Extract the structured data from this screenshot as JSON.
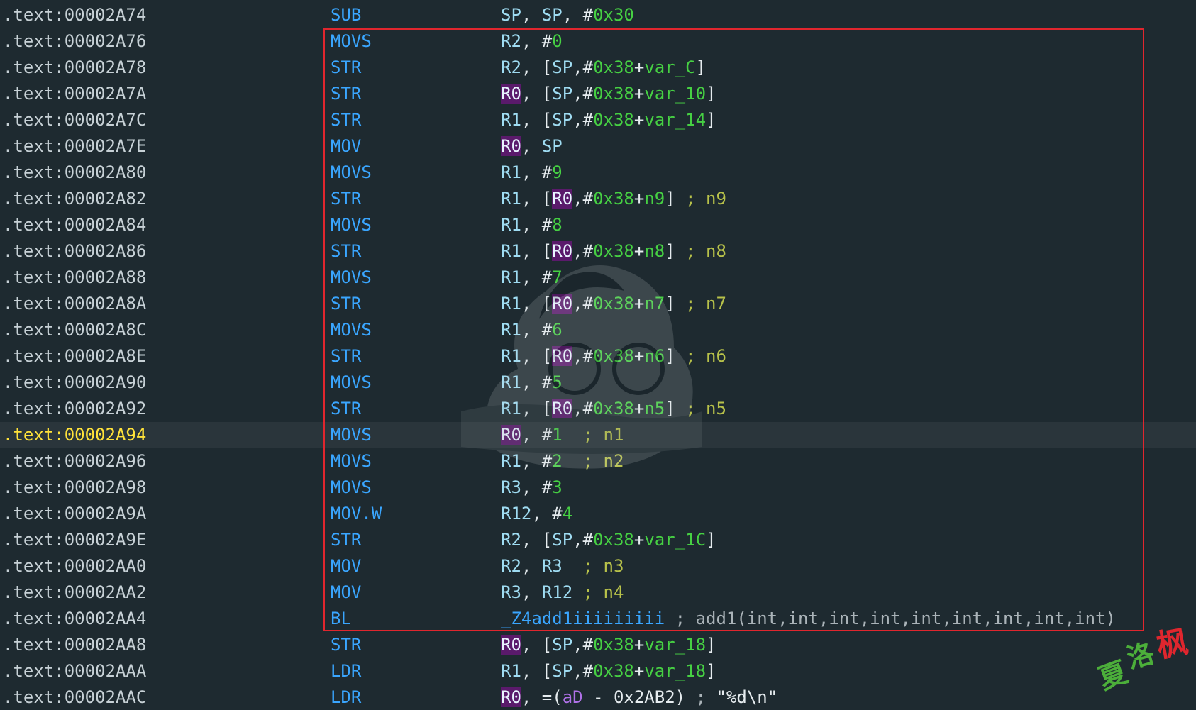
{
  "rows": [
    {
      "addr": ".text:00002A74",
      "mnem": "SUB",
      "ops": [
        [
          "reg",
          "SP"
        ],
        [
          "punc",
          ", "
        ],
        [
          "reg",
          "SP"
        ],
        [
          "punc",
          ", #"
        ],
        [
          "num",
          "0x30"
        ]
      ]
    },
    {
      "addr": ".text:00002A76",
      "mnem": "MOVS",
      "ops": [
        [
          "reg",
          "R2"
        ],
        [
          "punc",
          ", #"
        ],
        [
          "num",
          "0"
        ]
      ]
    },
    {
      "addr": ".text:00002A78",
      "mnem": "STR",
      "ops": [
        [
          "reg",
          "R2"
        ],
        [
          "punc",
          ", ["
        ],
        [
          "reg",
          "SP"
        ],
        [
          "punc",
          ",#"
        ],
        [
          "num",
          "0x38"
        ],
        [
          "punc",
          "+"
        ],
        [
          "var",
          "var_C"
        ],
        [
          "punc",
          "]"
        ]
      ]
    },
    {
      "addr": ".text:00002A7A",
      "mnem": "STR",
      "ops": [
        [
          "hl",
          "R0"
        ],
        [
          "punc",
          ", ["
        ],
        [
          "reg",
          "SP"
        ],
        [
          "punc",
          ",#"
        ],
        [
          "num",
          "0x38"
        ],
        [
          "punc",
          "+"
        ],
        [
          "var",
          "var_10"
        ],
        [
          "punc",
          "]"
        ]
      ]
    },
    {
      "addr": ".text:00002A7C",
      "mnem": "STR",
      "ops": [
        [
          "reg",
          "R1"
        ],
        [
          "punc",
          ", ["
        ],
        [
          "reg",
          "SP"
        ],
        [
          "punc",
          ",#"
        ],
        [
          "num",
          "0x38"
        ],
        [
          "punc",
          "+"
        ],
        [
          "var",
          "var_14"
        ],
        [
          "punc",
          "]"
        ]
      ]
    },
    {
      "addr": ".text:00002A7E",
      "mnem": "MOV",
      "ops": [
        [
          "hl",
          "R0"
        ],
        [
          "punc",
          ", "
        ],
        [
          "reg",
          "SP"
        ]
      ]
    },
    {
      "addr": ".text:00002A80",
      "mnem": "MOVS",
      "ops": [
        [
          "reg",
          "R1"
        ],
        [
          "punc",
          ", #"
        ],
        [
          "num",
          "9"
        ]
      ]
    },
    {
      "addr": ".text:00002A82",
      "mnem": "STR",
      "ops": [
        [
          "reg",
          "R1"
        ],
        [
          "punc",
          ", ["
        ],
        [
          "hl",
          "R0"
        ],
        [
          "punc",
          ",#"
        ],
        [
          "num",
          "0x38"
        ],
        [
          "punc",
          "+"
        ],
        [
          "var",
          "n9"
        ],
        [
          "punc",
          "] "
        ],
        [
          "cmt",
          "; n9"
        ]
      ]
    },
    {
      "addr": ".text:00002A84",
      "mnem": "MOVS",
      "ops": [
        [
          "reg",
          "R1"
        ],
        [
          "punc",
          ", #"
        ],
        [
          "num",
          "8"
        ]
      ]
    },
    {
      "addr": ".text:00002A86",
      "mnem": "STR",
      "ops": [
        [
          "reg",
          "R1"
        ],
        [
          "punc",
          ", ["
        ],
        [
          "hl",
          "R0"
        ],
        [
          "punc",
          ",#"
        ],
        [
          "num",
          "0x38"
        ],
        [
          "punc",
          "+"
        ],
        [
          "var",
          "n8"
        ],
        [
          "punc",
          "] "
        ],
        [
          "cmt",
          "; n8"
        ]
      ]
    },
    {
      "addr": ".text:00002A88",
      "mnem": "MOVS",
      "ops": [
        [
          "reg",
          "R1"
        ],
        [
          "punc",
          ", #"
        ],
        [
          "num",
          "7"
        ]
      ]
    },
    {
      "addr": ".text:00002A8A",
      "mnem": "STR",
      "ops": [
        [
          "reg",
          "R1"
        ],
        [
          "punc",
          ", ["
        ],
        [
          "hl",
          "R0"
        ],
        [
          "punc",
          ",#"
        ],
        [
          "num",
          "0x38"
        ],
        [
          "punc",
          "+"
        ],
        [
          "var",
          "n7"
        ],
        [
          "punc",
          "] "
        ],
        [
          "cmt",
          "; n7"
        ]
      ]
    },
    {
      "addr": ".text:00002A8C",
      "mnem": "MOVS",
      "ops": [
        [
          "reg",
          "R1"
        ],
        [
          "punc",
          ", #"
        ],
        [
          "num",
          "6"
        ]
      ]
    },
    {
      "addr": ".text:00002A8E",
      "mnem": "STR",
      "ops": [
        [
          "reg",
          "R1"
        ],
        [
          "punc",
          ", ["
        ],
        [
          "hl",
          "R0"
        ],
        [
          "punc",
          ",#"
        ],
        [
          "num",
          "0x38"
        ],
        [
          "punc",
          "+"
        ],
        [
          "var",
          "n6"
        ],
        [
          "punc",
          "] "
        ],
        [
          "cmt",
          "; n6"
        ]
      ]
    },
    {
      "addr": ".text:00002A90",
      "mnem": "MOVS",
      "ops": [
        [
          "reg",
          "R1"
        ],
        [
          "punc",
          ", #"
        ],
        [
          "num",
          "5"
        ]
      ]
    },
    {
      "addr": ".text:00002A92",
      "mnem": "STR",
      "ops": [
        [
          "reg",
          "R1"
        ],
        [
          "punc",
          ", ["
        ],
        [
          "hl",
          "R0"
        ],
        [
          "punc",
          ",#"
        ],
        [
          "num",
          "0x38"
        ],
        [
          "punc",
          "+"
        ],
        [
          "var",
          "n5"
        ],
        [
          "punc",
          "] "
        ],
        [
          "cmt",
          "; n5"
        ]
      ]
    },
    {
      "addr": ".text:00002A94",
      "mnem": "MOVS",
      "current": true,
      "ops": [
        [
          "hl",
          "R0"
        ],
        [
          "punc",
          ", #"
        ],
        [
          "num",
          "1"
        ],
        [
          "punc",
          "  "
        ],
        [
          "cmt",
          "; n1"
        ]
      ]
    },
    {
      "addr": ".text:00002A96",
      "mnem": "MOVS",
      "ops": [
        [
          "reg",
          "R1"
        ],
        [
          "punc",
          ", #"
        ],
        [
          "num",
          "2"
        ],
        [
          "punc",
          "  "
        ],
        [
          "cmt",
          "; n2"
        ]
      ]
    },
    {
      "addr": ".text:00002A98",
      "mnem": "MOVS",
      "ops": [
        [
          "reg",
          "R3"
        ],
        [
          "punc",
          ", #"
        ],
        [
          "num",
          "3"
        ]
      ]
    },
    {
      "addr": ".text:00002A9A",
      "mnem": "MOV.W",
      "ops": [
        [
          "reg",
          "R12"
        ],
        [
          "punc",
          ", #"
        ],
        [
          "num",
          "4"
        ]
      ]
    },
    {
      "addr": ".text:00002A9E",
      "mnem": "STR",
      "ops": [
        [
          "reg",
          "R2"
        ],
        [
          "punc",
          ", ["
        ],
        [
          "reg",
          "SP"
        ],
        [
          "punc",
          ",#"
        ],
        [
          "num",
          "0x38"
        ],
        [
          "punc",
          "+"
        ],
        [
          "var",
          "var_1C"
        ],
        [
          "punc",
          "]"
        ]
      ]
    },
    {
      "addr": ".text:00002AA0",
      "mnem": "MOV",
      "ops": [
        [
          "reg",
          "R2"
        ],
        [
          "punc",
          ", "
        ],
        [
          "reg",
          "R3"
        ],
        [
          "punc",
          "  "
        ],
        [
          "cmt",
          "; n3"
        ]
      ]
    },
    {
      "addr": ".text:00002AA2",
      "mnem": "MOV",
      "ops": [
        [
          "reg",
          "R3"
        ],
        [
          "punc",
          ", "
        ],
        [
          "reg",
          "R12"
        ],
        [
          "punc",
          " "
        ],
        [
          "cmt",
          "; n4"
        ]
      ]
    },
    {
      "addr": ".text:00002AA4",
      "mnem": "BL",
      "ops": [
        [
          "sym",
          "_Z4add1iiiiiiiii"
        ],
        [
          "punc",
          " "
        ],
        [
          "cmt2",
          "; add1(int,int,int,int,int,int,int,int,int)"
        ]
      ]
    },
    {
      "addr": ".text:00002AA8",
      "mnem": "STR",
      "ops": [
        [
          "hl",
          "R0"
        ],
        [
          "punc",
          ", ["
        ],
        [
          "reg",
          "SP"
        ],
        [
          "punc",
          ",#"
        ],
        [
          "num",
          "0x38"
        ],
        [
          "punc",
          "+"
        ],
        [
          "var",
          "var_18"
        ],
        [
          "punc",
          "]"
        ]
      ]
    },
    {
      "addr": ".text:00002AAA",
      "mnem": "LDR",
      "ops": [
        [
          "reg",
          "R1"
        ],
        [
          "punc",
          ", ["
        ],
        [
          "reg",
          "SP"
        ],
        [
          "punc",
          ",#"
        ],
        [
          "num",
          "0x38"
        ],
        [
          "punc",
          "+"
        ],
        [
          "var",
          "var_18"
        ],
        [
          "punc",
          "]"
        ]
      ]
    },
    {
      "addr": ".text:00002AAC",
      "mnem": "LDR",
      "ops": [
        [
          "hl",
          "R0"
        ],
        [
          "punc",
          ", =("
        ],
        [
          "sym2",
          "aD"
        ],
        [
          "punc",
          " - 0x2AB2) "
        ],
        [
          "cmt2",
          "; "
        ],
        [
          "str",
          "\"%d\\n\""
        ]
      ]
    }
  ],
  "stamp": {
    "chars": [
      "夏",
      "洛",
      "枫"
    ]
  },
  "colors": {
    "background": "#1e2a30",
    "selection_border": "#e0262e",
    "mnemonic": "#3aa6ff",
    "number": "#46d043",
    "highlight_register": "#5a1a6b",
    "current_address": "#ffe23a"
  }
}
